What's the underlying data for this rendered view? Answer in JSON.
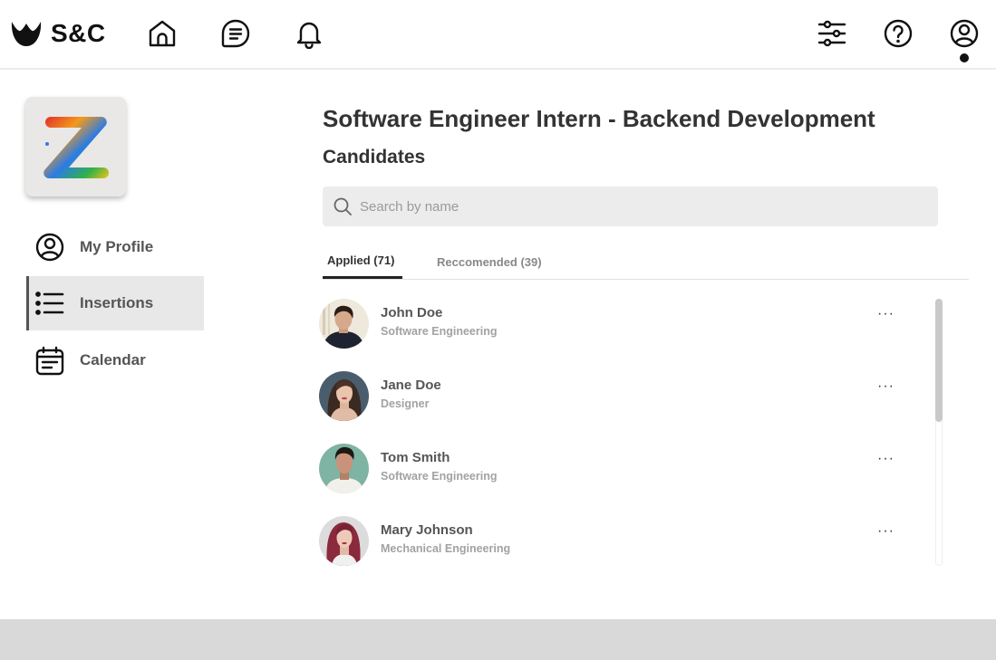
{
  "brand": {
    "name": "S&C"
  },
  "icons": {
    "home": "home-icon",
    "document": "document-icon",
    "notifications": "bell-icon",
    "filters": "sliders-icon",
    "help": "help-icon",
    "account": "user-circle-icon",
    "search": "search-icon",
    "more": "more-icon"
  },
  "sidebar": {
    "items": [
      {
        "label": "My Profile",
        "icon": "user-circle-icon",
        "active": false
      },
      {
        "label": "Insertions",
        "icon": "list-icon",
        "active": true
      },
      {
        "label": "Calendar",
        "icon": "calendar-icon",
        "active": false
      }
    ]
  },
  "main": {
    "job_title": "Software Engineer Intern - Backend Development",
    "section_title": "Candidates",
    "search": {
      "placeholder": "Search by name",
      "value": ""
    },
    "tabs": [
      {
        "label": "Applied (71)",
        "active": true
      },
      {
        "label": "Reccomended (39)",
        "active": false
      }
    ],
    "candidates": [
      {
        "name": "John Doe",
        "role": "Software Engineering",
        "more": "···"
      },
      {
        "name": "Jane Doe",
        "role": "Designer",
        "more": "···"
      },
      {
        "name": "Tom Smith",
        "role": "Software Engineering",
        "more": "···"
      },
      {
        "name": "Mary Johnson",
        "role": "Mechanical Engineering",
        "more": "···"
      }
    ]
  },
  "colors": {
    "active_nav_bg": "#e8e8e8",
    "search_bg": "#ececec",
    "footer_bg": "#d9d9d9",
    "text_primary": "#333333",
    "text_muted": "#a2a2a2"
  }
}
